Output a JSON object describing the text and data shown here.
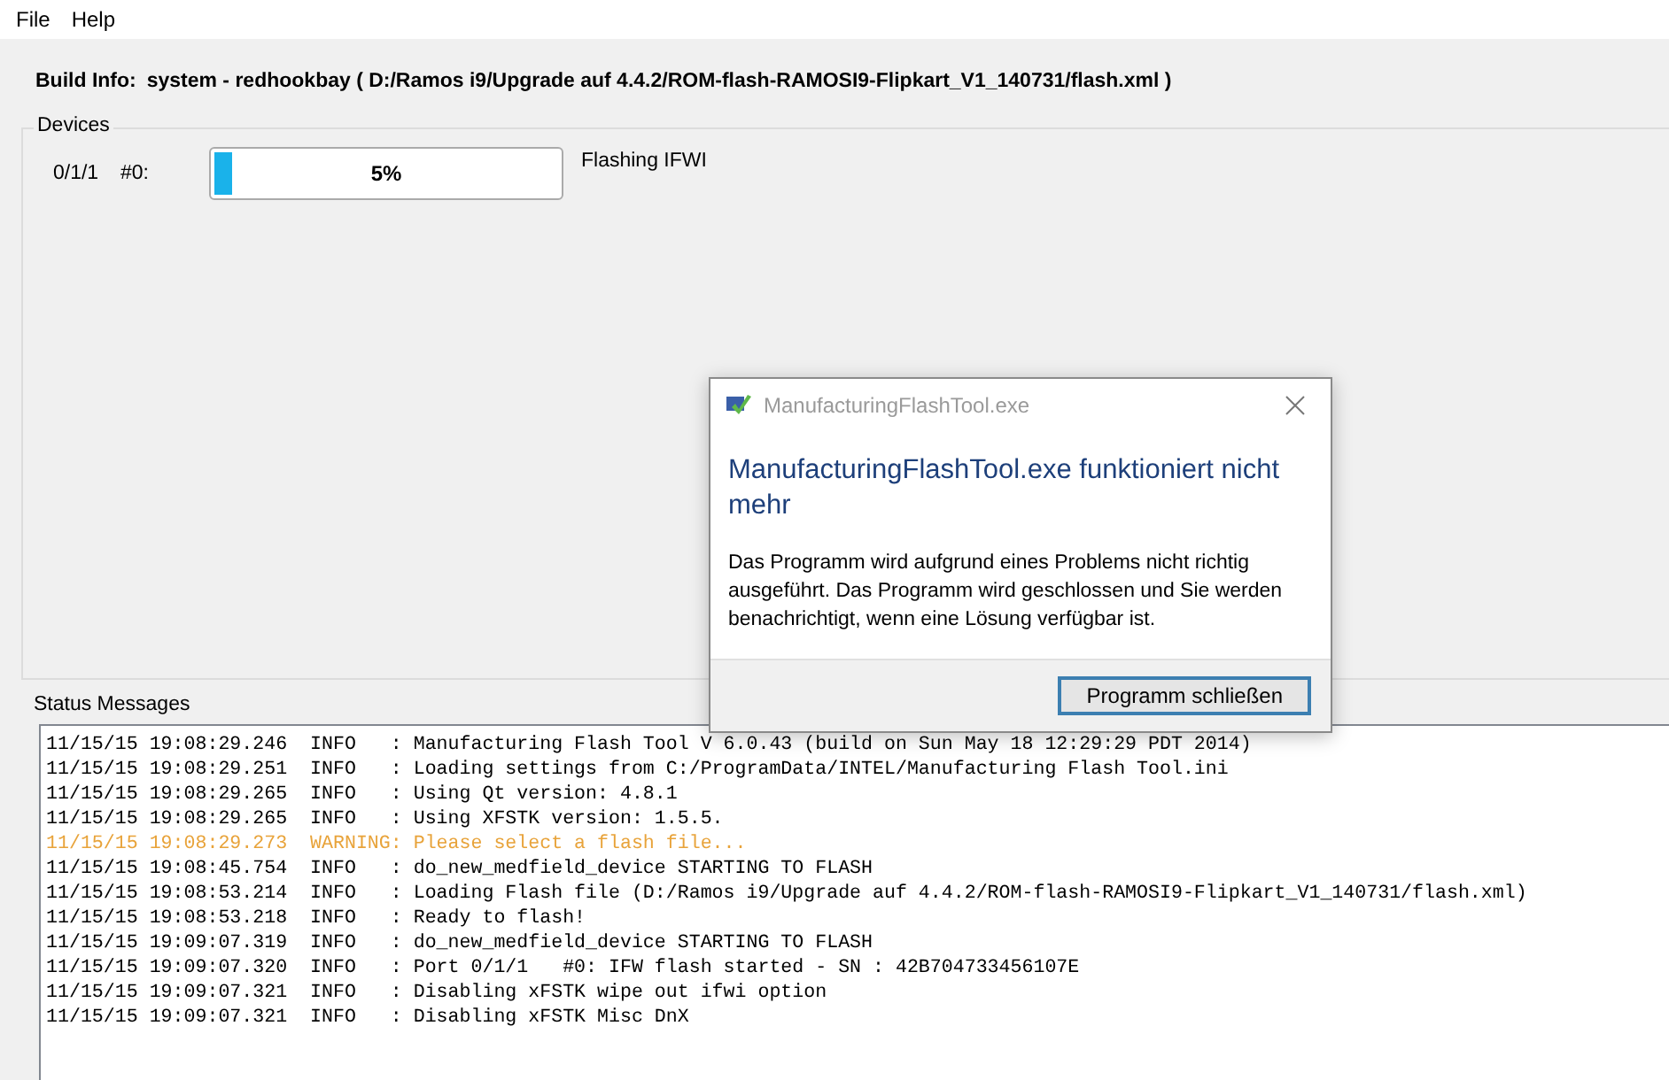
{
  "menu": [
    "File",
    "Help"
  ],
  "build_info": {
    "label": "Build Info:",
    "value": "system - redhookbay ( D:/Ramos i9/Upgrade auf 4.4.2/ROM-flash-RAMOSI9-Flipkart_V1_140731/flash.xml )"
  },
  "devices": {
    "title": "Devices",
    "items": [
      {
        "port": "0/1/1",
        "id": "#0:",
        "level": 0.05,
        "reading": "5%",
        "status": "Flashing IFWI"
      }
    ]
  },
  "status_messages": {
    "title": "Status Messages",
    "lines": [
      {
        "kind": "info",
        "text": "11/15/15 19:08:29.246  INFO   : Manufacturing Flash Tool V 6.0.43 (build on Sun May 18 12:29:29 PDT 2014)"
      },
      {
        "kind": "info",
        "text": "11/15/15 19:08:29.251  INFO   : Loading settings from C:/ProgramData/INTEL/Manufacturing Flash Tool.ini"
      },
      {
        "kind": "info",
        "text": "11/15/15 19:08:29.265  INFO   : Using Qt version: 4.8.1"
      },
      {
        "kind": "info",
        "text": "11/15/15 19:08:29.265  INFO   : Using XFSTK version: 1.5.5."
      },
      {
        "kind": "warning",
        "text": "11/15/15 19:08:29.273  WARNING: Please select a flash file..."
      },
      {
        "kind": "info",
        "text": "11/15/15 19:08:45.754  INFO   : do_new_medfield_device STARTING TO FLASH"
      },
      {
        "kind": "info",
        "text": "11/15/15 19:08:53.214  INFO   : Loading Flash file (D:/Ramos i9/Upgrade auf 4.4.2/ROM-flash-RAMOSI9-Flipkart_V1_140731/flash.xml)"
      },
      {
        "kind": "info",
        "text": "11/15/15 19:08:53.218  INFO   : Ready to flash!"
      },
      {
        "kind": "info",
        "text": "11/15/15 19:09:07.319  INFO   : do_new_medfield_device STARTING TO FLASH"
      },
      {
        "kind": "info",
        "text": "11/15/15 19:09:07.320  INFO   : Port 0/1/1   #0: IFW flash started - SN : 42B704733456107E"
      },
      {
        "kind": "info",
        "text": "11/15/15 19:09:07.321  INFO   : Disabling xFSTK wipe out ifwi option"
      },
      {
        "kind": "info",
        "text": "11/15/15 19:09:07.321  INFO   : Disabling xFSTK Misc DnX"
      }
    ]
  },
  "dialog": {
    "title": "ManufacturingFlashTool.exe",
    "heading": "ManufacturingFlashTool.exe funktioniert nicht mehr",
    "message": "Das Programm wird aufgrund eines Problems nicht richtig ausgeführt. Das Programm wird geschlossen und Sie werden benachrichtigt, wenn eine Lösung verfügbar ist.",
    "button": "Programm schließen"
  }
}
